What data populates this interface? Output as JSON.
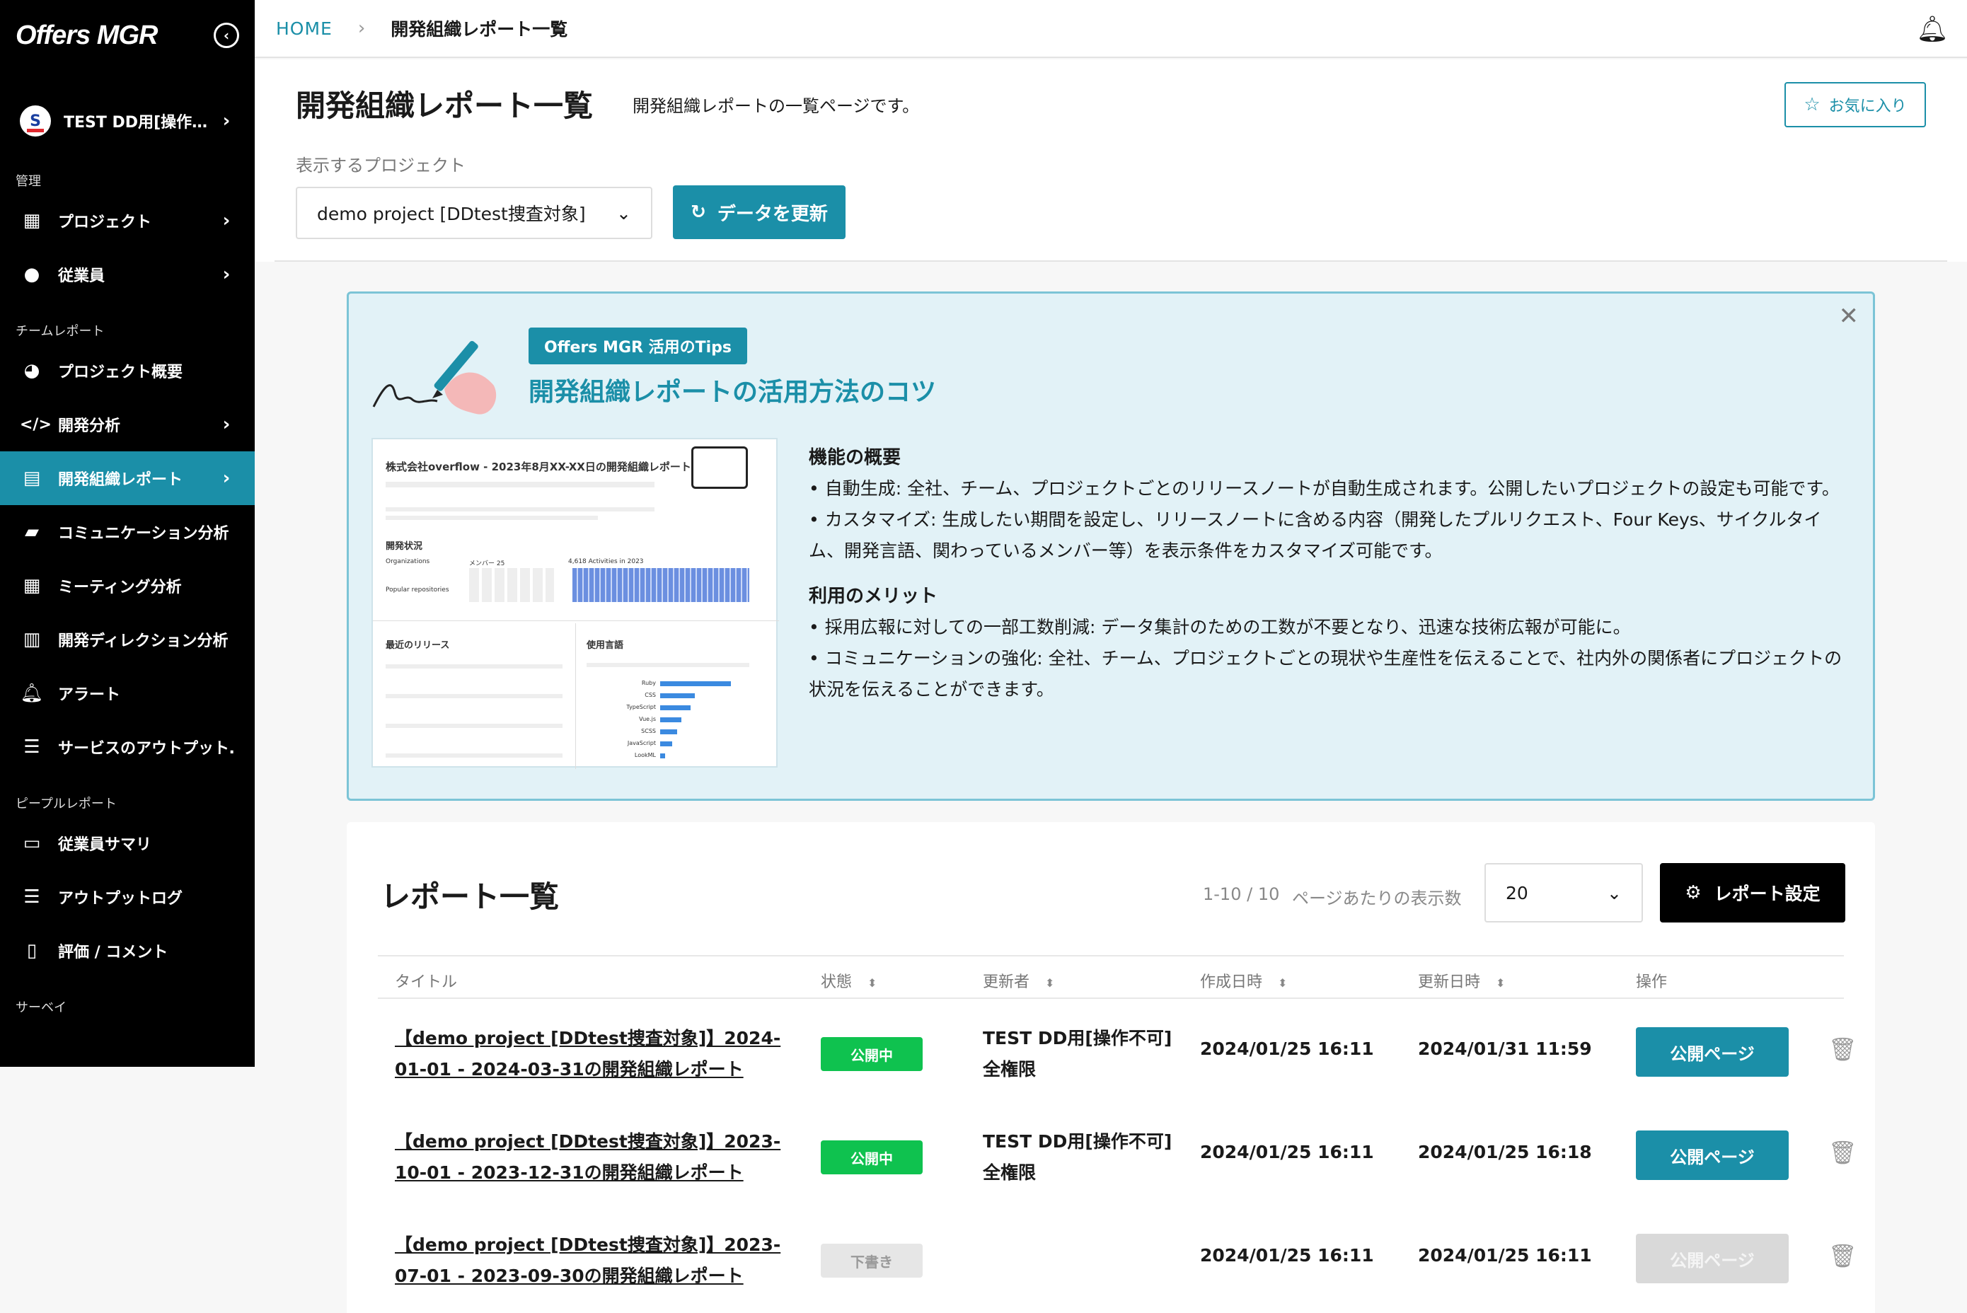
{
  "sidebar": {
    "logo": "Offers MGR",
    "org_name": "TEST DD用[操作…",
    "org_initial": "S",
    "sections": [
      {
        "label": "管理"
      },
      {
        "label": "チームレポート"
      },
      {
        "label": "ピープルレポート"
      },
      {
        "label": "サーベイ"
      }
    ],
    "items": [
      {
        "label": "プロジェクト",
        "icon": "building-icon"
      },
      {
        "label": "従業員",
        "icon": "user-icon"
      },
      {
        "label": "プロジェクト概要",
        "icon": "pie-chart-icon"
      },
      {
        "label": "開発分析",
        "icon": "code-icon"
      },
      {
        "label": "開発組織レポート",
        "icon": "report-icon"
      },
      {
        "label": "コミュニケーション分析",
        "icon": "chat-icon"
      },
      {
        "label": "ミーティング分析",
        "icon": "calendar-icon"
      },
      {
        "label": "開発ディレクション分析",
        "icon": "bar-chart-icon"
      },
      {
        "label": "アラート",
        "icon": "bell-icon"
      },
      {
        "label": "サービスのアウトプット…",
        "icon": "server-icon"
      },
      {
        "label": "従業員サマリ",
        "icon": "id-card-icon"
      },
      {
        "label": "アウトプットログ",
        "icon": "list-icon"
      },
      {
        "label": "評価 / コメント",
        "icon": "document-icon"
      }
    ]
  },
  "breadcrumb": {
    "home": "HOME",
    "current": "開発組織レポート一覧"
  },
  "header": {
    "title": "開発組織レポート一覧",
    "description": "開発組織レポートの一覧ページです。",
    "favorite_label": "お気に入り",
    "project_label": "表示するプロジェクト",
    "project_value": "demo project [DDtest捜査対象]",
    "refresh_label": "データを更新"
  },
  "tips": {
    "badge": "Offers MGR 活用のTips",
    "heading": "開発組織レポートの活用方法のコツ",
    "section1_title": "機能の概要",
    "section1_items": [
      "• 自動生成: 全社、チーム、プロジェクトごとのリリースノートが自動生成されます。公開したいプロジェクトの設定も可能です。",
      "• カスタマイズ: 生成したい期間を設定し、リリースノートに含める内容（開発したプルリクエスト、Four Keys、サイクルタイム、開発言語、関わっているメンバー等）を表示条件をカスタマイズ可能です。"
    ],
    "section2_title": "利用のメリット",
    "section2_items": [
      "• 採用広報に対しての一部工数削減: データ集計のための工数が不要となり、迅速な技術広報が可能に。",
      "• コミュニケーションの強化: 全社、チーム、プロジェクトごとの現状や生産性を伝えることで、社内外の関係者にプロジェクトの状況を伝えることができます。"
    ],
    "preview": {
      "title": "株式会社overflow - 2023年8月XX-XX日の開発組織レポート",
      "dev_status": "開発状況",
      "orgs": "Organizations",
      "members": "メンバー 25",
      "activities": "4,618 Activities in 2023",
      "repos": "Popular repositories",
      "releases": "最近のリリース",
      "languages": "使用言語",
      "lang_names": [
        "Ruby",
        "CSS",
        "TypeScript",
        "Vue.js",
        "SCSS",
        "JavaScript",
        "LookML"
      ],
      "lang_values": [
        83,
        41,
        36,
        25,
        20,
        14,
        6
      ]
    }
  },
  "list": {
    "title": "レポート一覧",
    "pager": "1-10 / 10",
    "per_page_label": "ページあたりの表示数",
    "per_page_value": "20",
    "settings_label": "レポート設定",
    "columns": [
      "タイトル",
      "状態",
      "更新者",
      "作成日時",
      "更新日時",
      "操作"
    ],
    "rows": [
      {
        "title": "【demo project [DDtest捜査対象]】2024-01-01 - 2024-03-31の開発組織レポート",
        "status": "公開中",
        "updater1": "TEST DD用[操作不可]",
        "updater2": "全権限",
        "created": "2024/01/25 16:11",
        "updated": "2024/01/31 11:59",
        "action": "公開ページ"
      },
      {
        "title": "【demo project [DDtest捜査対象]】2023-10-01 - 2023-12-31の開発組織レポート",
        "status": "公開中",
        "updater1": "TEST DD用[操作不可]",
        "updater2": "全権限",
        "created": "2024/01/25 16:11",
        "updated": "2024/01/25 16:18",
        "action": "公開ページ"
      },
      {
        "title": "【demo project [DDtest捜査対象]】2023-07-01 - 2023-09-30の開発組織レポート",
        "status": "下書き",
        "updater1": "",
        "updater2": "",
        "created": "2024/01/25 16:11",
        "updated": "2024/01/25 16:11",
        "action": "公開ページ"
      }
    ]
  },
  "colors": {
    "accent": "#1b8fa8",
    "published": "#0fc24f",
    "sidebar": "#000000"
  }
}
